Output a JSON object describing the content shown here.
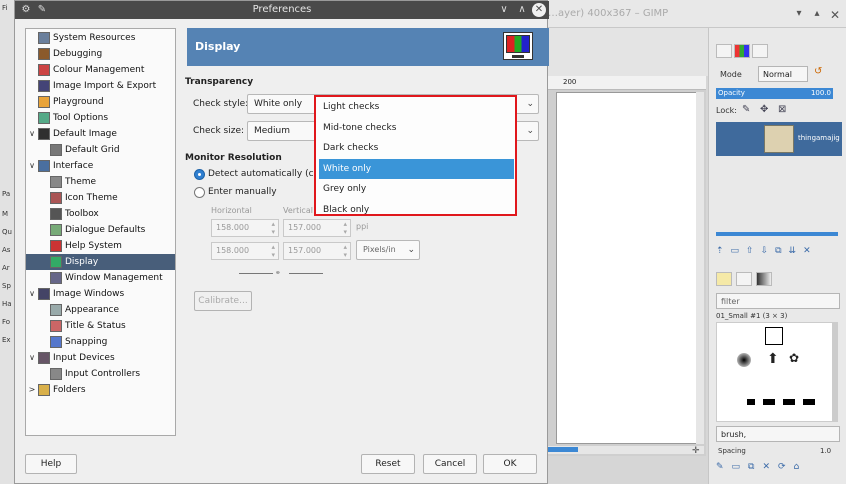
{
  "background_app": {
    "title": "…ayer) 400x367 – GIMP",
    "layers_panel": {
      "mode_label": "Mode",
      "mode_value": "Normal",
      "opacity_label": "Opacity",
      "opacity_value": "100.0",
      "lock_label": "Lock:",
      "layer_name": "thingamajig"
    },
    "brushes_panel": {
      "filter_placeholder": "filter",
      "brush_title": "01_Small #1 (3 × 3)",
      "brush_tag": "brush,",
      "spacing_label": "Spacing",
      "spacing_value": "1.0"
    },
    "ruler_label": "200",
    "left_toolbox_labels": [
      "Fi",
      "Pa",
      "M",
      "Qu",
      "As",
      "Ar",
      "Sp",
      "Ha",
      "Fo",
      "Ex"
    ]
  },
  "dialog": {
    "title": "Preferences",
    "tree": [
      {
        "label": "System Resources",
        "level": 0,
        "expander": "",
        "icon": "system-resources-icon"
      },
      {
        "label": "Debugging",
        "level": 0,
        "expander": "",
        "icon": "debugging-icon"
      },
      {
        "label": "Colour Management",
        "level": 0,
        "expander": "",
        "icon": "colour-management-icon"
      },
      {
        "label": "Image Import & Export",
        "level": 0,
        "expander": "",
        "icon": "image-import-export-icon"
      },
      {
        "label": "Playground",
        "level": 0,
        "expander": "",
        "icon": "playground-icon"
      },
      {
        "label": "Tool Options",
        "level": 0,
        "expander": "",
        "icon": "tool-options-icon"
      },
      {
        "label": "Default Image",
        "level": 0,
        "expander": "∨",
        "icon": "default-image-icon"
      },
      {
        "label": "Default Grid",
        "level": 1,
        "expander": "",
        "icon": "default-grid-icon"
      },
      {
        "label": "Interface",
        "level": 0,
        "expander": "∨",
        "icon": "interface-icon"
      },
      {
        "label": "Theme",
        "level": 1,
        "expander": "",
        "icon": "theme-icon"
      },
      {
        "label": "Icon Theme",
        "level": 1,
        "expander": "",
        "icon": "icon-theme-icon"
      },
      {
        "label": "Toolbox",
        "level": 1,
        "expander": "",
        "icon": "toolbox-icon"
      },
      {
        "label": "Dialogue Defaults",
        "level": 1,
        "expander": "",
        "icon": "dialogue-defaults-icon"
      },
      {
        "label": "Help System",
        "level": 1,
        "expander": "",
        "icon": "help-system-icon"
      },
      {
        "label": "Display",
        "level": 1,
        "expander": "",
        "icon": "display-icon",
        "selected": true
      },
      {
        "label": "Window Management",
        "level": 1,
        "expander": "",
        "icon": "window-management-icon"
      },
      {
        "label": "Image Windows",
        "level": 0,
        "expander": "∨",
        "icon": "image-windows-icon"
      },
      {
        "label": "Appearance",
        "level": 1,
        "expander": "",
        "icon": "appearance-icon"
      },
      {
        "label": "Title & Status",
        "level": 1,
        "expander": "",
        "icon": "title-status-icon"
      },
      {
        "label": "Snapping",
        "level": 1,
        "expander": "",
        "icon": "snapping-icon"
      },
      {
        "label": "Input Devices",
        "level": 0,
        "expander": "∨",
        "icon": "input-devices-icon"
      },
      {
        "label": "Input Controllers",
        "level": 1,
        "expander": "",
        "icon": "input-controllers-icon"
      },
      {
        "label": "Folders",
        "level": 0,
        "expander": ">",
        "icon": "folders-icon"
      }
    ],
    "header": {
      "title": "Display"
    },
    "transparency": {
      "section_title": "Transparency",
      "check_style_label": "Check style:",
      "check_style_value": "White only",
      "check_size_label": "Check size:",
      "check_size_value": "Medium"
    },
    "monitor": {
      "section_title": "Monitor Resolution",
      "detect_label": "Detect automatically (curr",
      "manual_label": "Enter manually",
      "horizontal_label": "Horizontal",
      "vertical_label": "Vertical",
      "h_value_1": "158.000",
      "v_value_1": "157.000",
      "h_value_2": "158.000",
      "v_value_2": "157.000",
      "unit_label": "ppi",
      "unit_select": "Pixels/in",
      "calibrate_label": "Calibrate..."
    },
    "dropdown_options": [
      {
        "label": "Light checks"
      },
      {
        "label": "Mid-tone checks"
      },
      {
        "label": "Dark checks"
      },
      {
        "label": "White only",
        "selected": true
      },
      {
        "label": "Grey only"
      },
      {
        "label": "Black only"
      }
    ],
    "buttons": {
      "help": "Help",
      "reset": "Reset",
      "cancel": "Cancel",
      "ok": "OK"
    }
  },
  "colors": {
    "selection_blue": "#3a95d8",
    "highlight_border": "#e0171c",
    "tree_selected": "#485e7a",
    "header_banner": "#5583b4"
  }
}
